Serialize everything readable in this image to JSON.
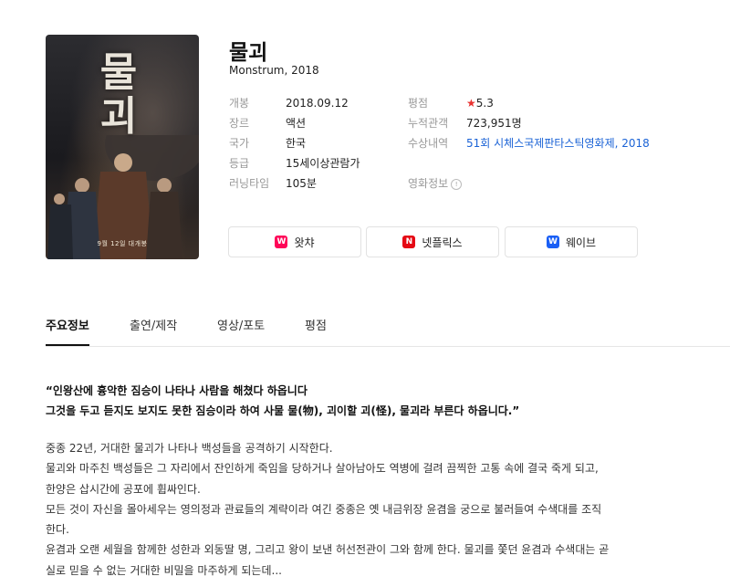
{
  "movie": {
    "title": "물괴",
    "subtitle": "Monstrum, 2018",
    "poster": {
      "title_text": "물괴",
      "release_text": "9월 12일 대개봉"
    }
  },
  "info_left": [
    {
      "label": "개봉",
      "value": "2018.09.12"
    },
    {
      "label": "장르",
      "value": "액션"
    },
    {
      "label": "국가",
      "value": "한국"
    },
    {
      "label": "등급",
      "value": "15세이상관람가"
    },
    {
      "label": "러닝타임",
      "value": "105분"
    }
  ],
  "info_right": {
    "rating_label": "평점",
    "rating_value": "5.3",
    "audience_label": "누적관객",
    "audience_value": "723,951명",
    "award_label": "수상내역",
    "award_value": "51회 시체스국제판타스틱영화제, 2018",
    "movie_info_label": "영화정보"
  },
  "ott": [
    {
      "label": "왓챠",
      "logo": "W",
      "color": "#ff0558",
      "icon": "watcha-icon"
    },
    {
      "label": "넷플릭스",
      "logo": "N",
      "color": "#e50914",
      "icon": "netflix-icon"
    },
    {
      "label": "웨이브",
      "logo": "W",
      "color": "#1a5ff5",
      "icon": "wavve-icon"
    }
  ],
  "tabs": [
    "주요정보",
    "출연/제작",
    "영상/포토",
    "평점"
  ],
  "quote": [
    "“인왕산에 흉악한 짐승이 나타나 사람을 해쳤다 하옵니다",
    "그것을 두고 듣지도 보지도 못한 짐승이라 하여 사물 물(物), 괴이할 괴(怪), 물괴라 부른다 하옵니다.”"
  ],
  "synopsis": [
    "중종 22년, 거대한 물괴가 나타나 백성들을 공격하기 시작한다.",
    "물괴와 마주친 백성들은 그 자리에서 잔인하게 죽임을 당하거나 살아남아도 역병에 걸려 끔찍한 고통 속에 결국 죽게 되고,",
    "한양은 삽시간에 공포에 휩싸인다.",
    "모든 것이 자신을 몰아세우는 영의정과 관료들의 계략이라 여긴 중종은 옛 내금위장 윤겸을 궁으로 불러들여 수색대를 조직",
    "한다.",
    "윤겸과 오랜 세월을 함께한 성한과 외동딸 명, 그리고 왕이 보낸 허선전관이 그와 함께 한다. 물괴를 쫓던 윤겸과 수색대는 곧",
    "실로 믿을 수 없는 거대한 비밀을 마주하게 되는데..."
  ],
  "colors": {
    "accent_star": "#e8312f",
    "link": "#1b63d6"
  }
}
